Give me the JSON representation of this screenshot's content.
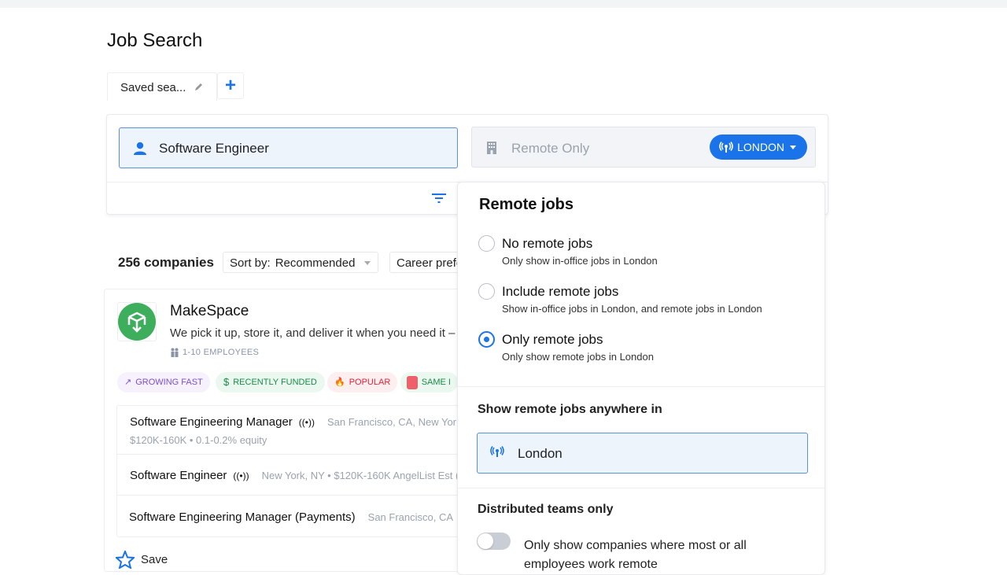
{
  "page": {
    "title": "Job Search"
  },
  "tabs": {
    "saved_search": "Saved sea...",
    "add_label": "+"
  },
  "search": {
    "role_value": "Software Engineer",
    "location_value": "Remote Only",
    "location_pill": "LONDON"
  },
  "results": {
    "count": "256 companies",
    "sort_label": "Sort by:",
    "sort_value": "Recommended",
    "career_prefs": "Career prefe"
  },
  "company": {
    "name": "MakeSpace",
    "description": "We pick it up, store it, and deliver it when you need it –",
    "employees": "1-10 EMPLOYEES",
    "badges": [
      {
        "label": "GROWING FAST",
        "color": "#7b4fd0",
        "bg": "#f6f1fd"
      },
      {
        "label": "RECENTLY FUNDED",
        "color": "#1a8a4a",
        "bg": "#eaf8ef"
      },
      {
        "label": "POPULAR",
        "color": "#e0243a",
        "bg": "#fdeef0"
      },
      {
        "label": "SAME I",
        "color": "#1a8a4a",
        "bg": "#eaf8ef"
      }
    ],
    "jobs": [
      {
        "title": "Software Engineering Manager",
        "meta": "San Francisco, CA, New Yor",
        "sub": "$120K-160K • 0.1-0.2% equity",
        "remote": true
      },
      {
        "title": "Software Engineer",
        "meta": "New York, NY • $120K-160K AngelList Est (",
        "remote": true
      },
      {
        "title": "Software Engineering Manager (Payments)",
        "meta": "San Francisco, CA",
        "remote": false
      }
    ],
    "save_label": "Save"
  },
  "remote_popover": {
    "title": "Remote jobs",
    "options": [
      {
        "label": "No remote jobs",
        "desc": "Only show in-office jobs in London",
        "selected": false
      },
      {
        "label": "Include remote jobs",
        "desc": "Show in-office jobs in London, and remote jobs in London",
        "selected": false
      },
      {
        "label": "Only remote jobs",
        "desc": "Only show remote jobs in London",
        "selected": true
      }
    ],
    "anywhere_heading": "Show remote jobs anywhere in",
    "anywhere_value": "London",
    "distributed_heading": "Distributed teams only",
    "distributed_label": "Only show companies where most or all employees work remote",
    "distributed_on": false
  },
  "colors": {
    "accent": "#1a73e8",
    "logo": "#3dae5c"
  }
}
